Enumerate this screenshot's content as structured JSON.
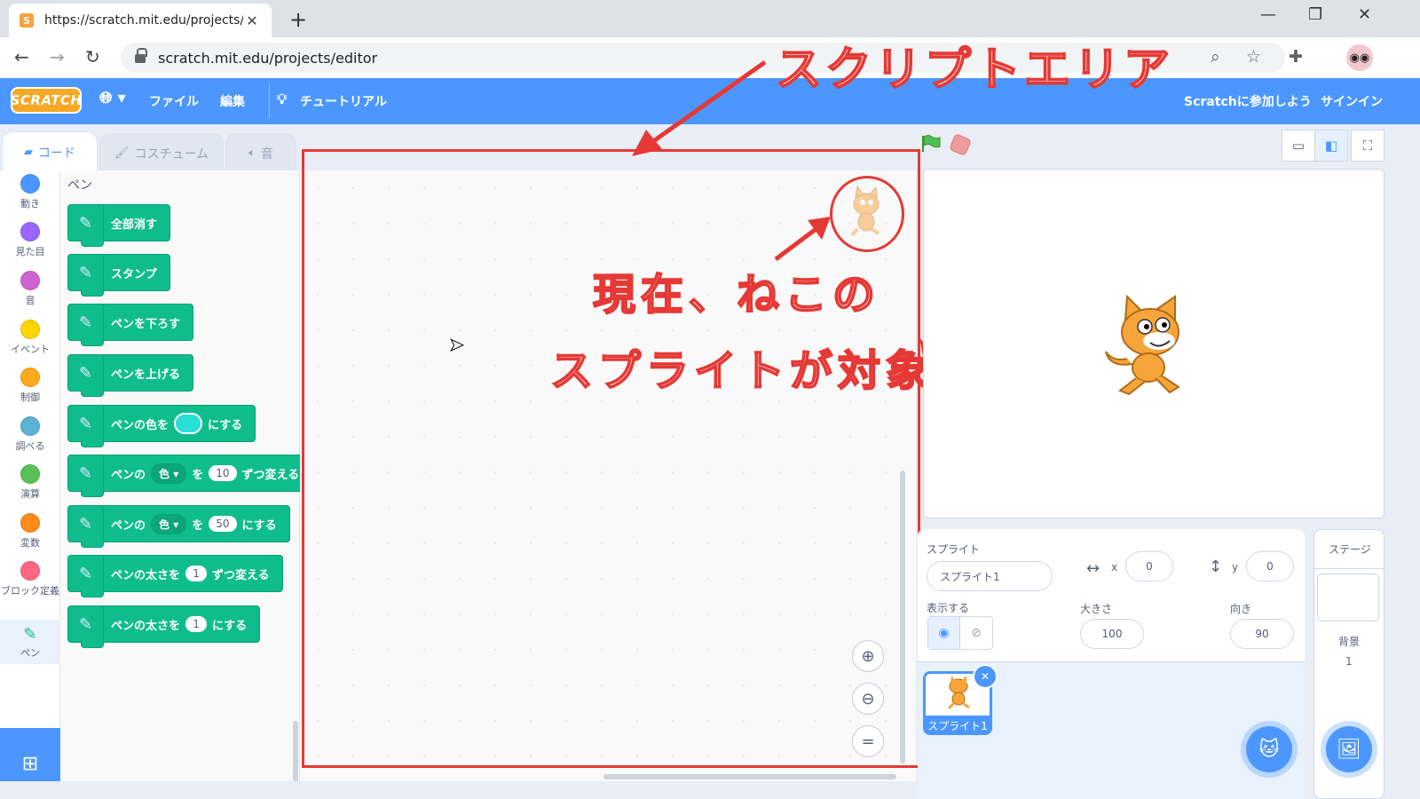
{
  "browser": {
    "tab_title": "https://scratch.mit.edu/projects/e",
    "url": "scratch.mit.edu/projects/editor"
  },
  "menubar": {
    "logo": "SCRATCH",
    "file": "ファイル",
    "edit": "編集",
    "tutorials": "チュートリアル",
    "join": "Scratchに参加しよう",
    "signin": "サインイン"
  },
  "tabs": {
    "code": "コード",
    "costumes": "コスチューム",
    "sounds": "音"
  },
  "categories": [
    {
      "label": "動き",
      "color": "#4c97ff"
    },
    {
      "label": "見た目",
      "color": "#9966ff"
    },
    {
      "label": "音",
      "color": "#cf63cf"
    },
    {
      "label": "イベント",
      "color": "#ffd500"
    },
    {
      "label": "制御",
      "color": "#ffab19"
    },
    {
      "label": "調べる",
      "color": "#5cb1d6"
    },
    {
      "label": "演算",
      "color": "#59c059"
    },
    {
      "label": "変数",
      "color": "#ff8c1a"
    },
    {
      "label": "ブロック定義",
      "color": "#ff6680"
    },
    {
      "label": "ペン",
      "color": "#0fbd8c"
    }
  ],
  "palette": {
    "section_title": "ペン",
    "blocks": {
      "clear": "全部消す",
      "stamp": "スタンプ",
      "pen_down": "ペンを下ろす",
      "pen_up": "ペンを上げる",
      "set_color_a": "ペンの色を",
      "set_color_b": "にする",
      "change_param_a": "ペンの",
      "change_param_dd": "色",
      "change_param_b": "を",
      "change_param_val": "10",
      "change_param_c": "ずつ変える",
      "set_param_a": "ペンの",
      "set_param_dd": "色",
      "set_param_b": "を",
      "set_param_val": "50",
      "set_param_c": "にする",
      "change_size_a": "ペンの太さを",
      "change_size_val": "1",
      "change_size_b": "ずつ変える",
      "set_size_a": "ペンの太さを",
      "set_size_val": "1",
      "set_size_b": "にする"
    }
  },
  "annotations": {
    "title": "スクリプトエリア",
    "line1": "現在、ねこの",
    "line2": "スプライトが対象"
  },
  "sprite_info": {
    "sprite_label": "スプライト",
    "sprite_name": "スプライト1",
    "x_label": "x",
    "x_value": "0",
    "y_label": "y",
    "y_value": "0",
    "show_label": "表示する",
    "size_label": "大きさ",
    "size_value": "100",
    "direction_label": "向き",
    "direction_value": "90"
  },
  "sprite_list": {
    "sprite1": "スプライト1"
  },
  "stage_pane": {
    "header": "ステージ",
    "backdrops_label": "背景",
    "backdrops_count": "1"
  },
  "colors": {
    "scratch_blue": "#4c97ff",
    "pen_green": "#0fbd8c",
    "annotation_red": "#e53935"
  }
}
